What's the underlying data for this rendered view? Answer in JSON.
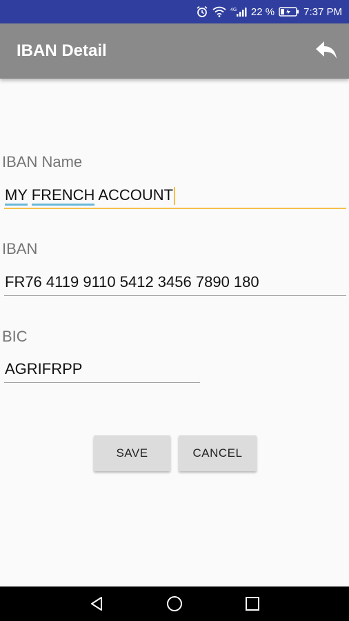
{
  "status_bar": {
    "battery_percent": "22 %",
    "time": "7:37 PM",
    "icons": [
      "alarm-icon",
      "wifi-icon",
      "cellular-signal-icon",
      "battery-charging-icon"
    ]
  },
  "app_bar": {
    "title": "IBAN Detail",
    "action_icon": "reply-back-icon"
  },
  "form": {
    "iban_name": {
      "label": "IBAN Name",
      "value": "MY FRENCH ACCOUNT",
      "word1": "MY",
      "word2": "FRENCH",
      "word3": "ACCOUNT",
      "focused": true
    },
    "iban": {
      "label": "IBAN",
      "value": "FR76 4119 9110 5412 3456 7890 180"
    },
    "bic": {
      "label": "BIC",
      "value": "AGRIFRPP"
    }
  },
  "buttons": {
    "save": "SAVE",
    "cancel": "CANCEL"
  },
  "nav_bar": {
    "icons": [
      "nav-back-icon",
      "nav-home-icon",
      "nav-recents-icon"
    ]
  },
  "colors": {
    "status_bar": "#303f9f",
    "app_bar": "#8a8a8a",
    "accent": "#f5c04a",
    "spellcheck_underline": "#6ab8d9"
  }
}
